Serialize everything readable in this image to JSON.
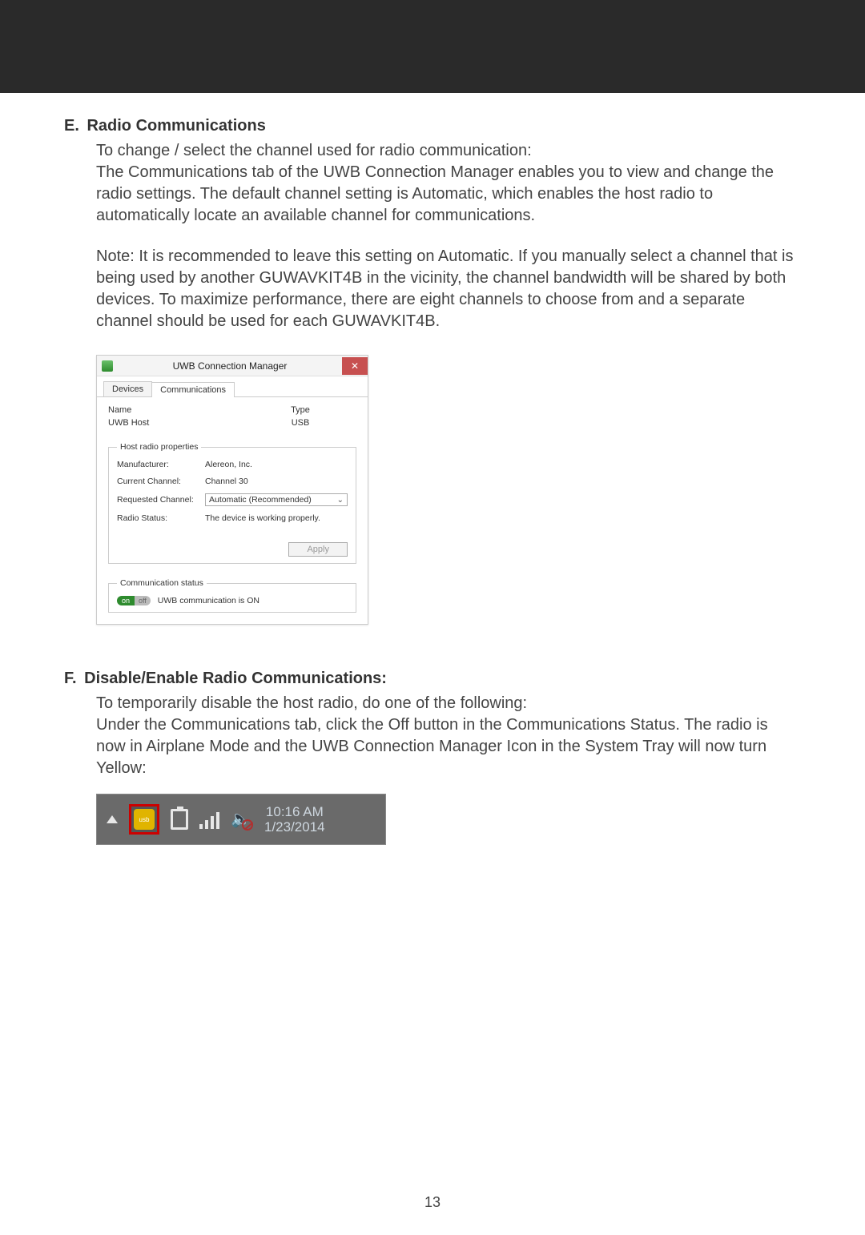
{
  "section_e": {
    "letter": "E.",
    "title": "Radio Communications",
    "para1": "To change / select the channel used for radio communication:",
    "para1b": "The Communications tab of the UWB Connection Manager enables you to view and change the radio settings. The default channel setting is Automatic, which enables the host radio to automatically locate an available channel for communications.",
    "para2": "Note: It is recommended to leave this setting on Automatic. If you manually select a channel that is being used by another GUWAVKIT4B in the vicinity, the channel bandwidth will be shared by both devices. To maximize performance, there are eight channels to choose from and a separate channel should be used for each GUWAVKIT4B."
  },
  "dialog": {
    "window_title": "UWB Connection Manager",
    "tabs": {
      "devices": "Devices",
      "communications": "Communications"
    },
    "table": {
      "header_name": "Name",
      "header_type": "Type",
      "row1_name": "UWB Host",
      "row1_type": "USB"
    },
    "host_props": {
      "legend": "Host radio properties",
      "manufacturer_label": "Manufacturer:",
      "manufacturer_value": "Alereon, Inc.",
      "current_channel_label": "Current Channel:",
      "current_channel_value": "Channel 30",
      "requested_channel_label": "Requested Channel:",
      "requested_channel_value": "Automatic (Recommended)",
      "radio_status_label": "Radio Status:",
      "radio_status_value": "The device is working properly."
    },
    "apply_label": "Apply",
    "comm_status": {
      "legend": "Communication status",
      "on": "on",
      "off": "off",
      "text": "UWB communication is ON"
    }
  },
  "section_f": {
    "letter": "F.",
    "title": "Disable/Enable Radio Communications:",
    "para1": "To temporarily disable the host radio, do one of the following:",
    "para1b": "Under the Communications tab, click the Off button in the Communications Status. The radio is now in Airplane Mode and the UWB Connection Manager Icon in the System Tray will now turn Yellow:"
  },
  "tray": {
    "usb_text": "usb",
    "time": "10:16 AM",
    "date": "1/23/2014"
  },
  "page_number": "13"
}
